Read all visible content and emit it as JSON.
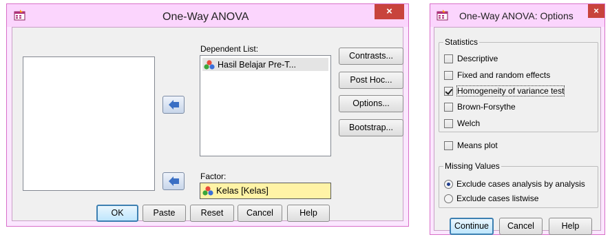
{
  "main_dialog": {
    "title": "One-Way ANOVA",
    "close_glyph": "×",
    "dependent_list_label": "Dependent List:",
    "dependent_items": [
      "Hasil Belajar  Pre-T..."
    ],
    "factor_label": "Factor:",
    "factor_value": "Kelas [Kelas]",
    "side_buttons": {
      "contrasts": "Contrasts...",
      "post_hoc": "Post Hoc...",
      "options": "Options...",
      "bootstrap": "Bootstrap..."
    },
    "bottom_buttons": {
      "ok": "OK",
      "paste": "Paste",
      "reset": "Reset",
      "cancel": "Cancel",
      "help": "Help"
    }
  },
  "options_dialog": {
    "title": "One-Way ANOVA: Options",
    "close_glyph": "×",
    "statistics_legend": "Statistics",
    "statistics": [
      {
        "label": "Descriptive",
        "checked": false
      },
      {
        "label": "Fixed and random effects",
        "checked": false
      },
      {
        "label": "Homogeneity of variance test",
        "checked": true
      },
      {
        "label": "Brown-Forsythe",
        "checked": false
      },
      {
        "label": "Welch",
        "checked": false
      }
    ],
    "means_plot": {
      "label": "Means plot",
      "checked": false
    },
    "missing_legend": "Missing Values",
    "missing_options": [
      {
        "label": "Exclude cases analysis by analysis",
        "selected": true
      },
      {
        "label": "Exclude cases listwise",
        "selected": false
      }
    ],
    "buttons": {
      "continue": "Continue",
      "cancel": "Cancel",
      "help": "Help"
    }
  },
  "colors": {
    "title_bar": "#fbd5fd",
    "close_button": "#c8433c",
    "dialog_body": "#f0f0f0",
    "factor_highlight": "#fff3a6",
    "arrow_blue": "#3a6fc4"
  },
  "icons": [
    "app-icon",
    "close-icon",
    "nominal-variable-icon",
    "arrow-left-icon"
  ]
}
